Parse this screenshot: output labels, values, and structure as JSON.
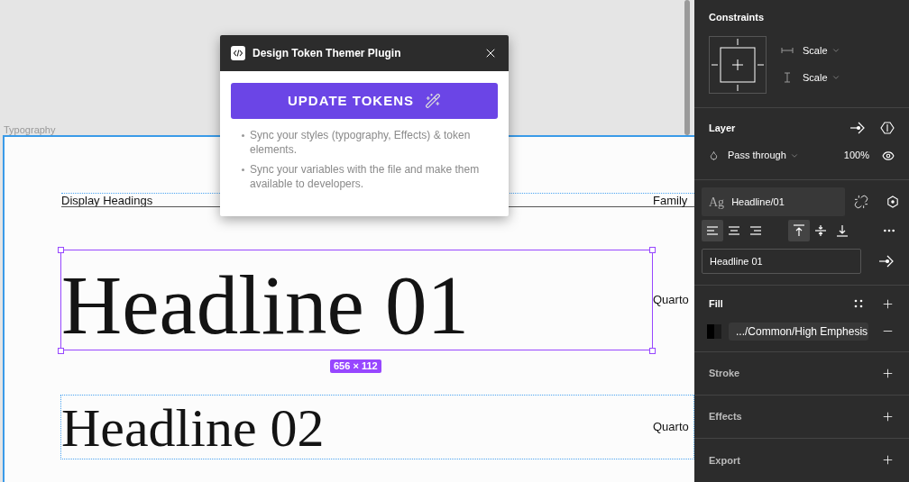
{
  "canvas": {
    "frame_label": "Typography",
    "section": {
      "heading": "Display Headings",
      "column": "Family"
    },
    "headlines": [
      {
        "text": "Headline 01",
        "family": "Quarto",
        "selected": true,
        "size": "656 × 112"
      },
      {
        "text": "Headline 02",
        "family": "Quarto",
        "selected": false
      }
    ]
  },
  "plugin": {
    "title": "Design Token Themer Plugin",
    "button": "UPDATE TOKENS",
    "bullets": [
      "Sync your styles (typography, Effects) & token elements.",
      "Sync your variables with the file and make them available to developers."
    ]
  },
  "panel": {
    "constraints": {
      "title": "Constraints",
      "horizontal": "Scale",
      "vertical": "Scale"
    },
    "layer": {
      "title": "Layer",
      "blend": "Pass through",
      "opacity": "100%"
    },
    "text": {
      "style_icon": "Ag",
      "style": "Headline/01",
      "align": [
        {
          "kind": "left",
          "selected": true
        },
        {
          "kind": "center",
          "selected": false
        },
        {
          "kind": "right",
          "selected": false
        }
      ],
      "valign": [
        {
          "kind": "top",
          "selected": true
        },
        {
          "kind": "middle",
          "selected": false
        },
        {
          "kind": "bottom",
          "selected": false
        }
      ],
      "name": "Headline 01"
    },
    "fill": {
      "title": "Fill",
      "value": ".../Common/High Emphesis"
    },
    "sections": [
      "Stroke",
      "Effects",
      "Export"
    ]
  }
}
